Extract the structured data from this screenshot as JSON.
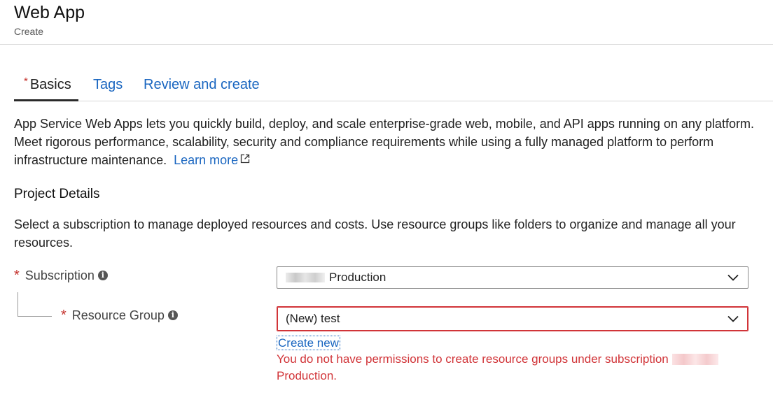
{
  "header": {
    "title": "Web App",
    "subtitle": "Create"
  },
  "tabs": [
    {
      "label": "Basics",
      "required": true,
      "active": true
    },
    {
      "label": "Tags"
    },
    {
      "label": "Review and create"
    }
  ],
  "intro": {
    "text": "App Service Web Apps lets you quickly build, deploy, and scale enterprise-grade web, mobile, and API apps running on any platform. Meet rigorous performance, scalability, security and compliance requirements while using a fully managed platform to perform infrastructure maintenance.",
    "learn_more": "Learn more",
    "learn_more_icon": "external-link-icon"
  },
  "project_details": {
    "title": "Project Details",
    "description": "Select a subscription to manage deployed resources and costs. Use resource groups like folders to organize and manage all your resources."
  },
  "form": {
    "required_marker": "*",
    "subscription": {
      "label": "Subscription",
      "value": "Production"
    },
    "resource_group": {
      "label": "Resource Group",
      "value": "(New) test",
      "create_new": "Create new",
      "error": "You do not have permissions to create resource groups under subscription",
      "error_tail": "Production."
    }
  },
  "colors": {
    "link": "#1a66c0",
    "error": "#d13438",
    "required": "#c4302b"
  }
}
